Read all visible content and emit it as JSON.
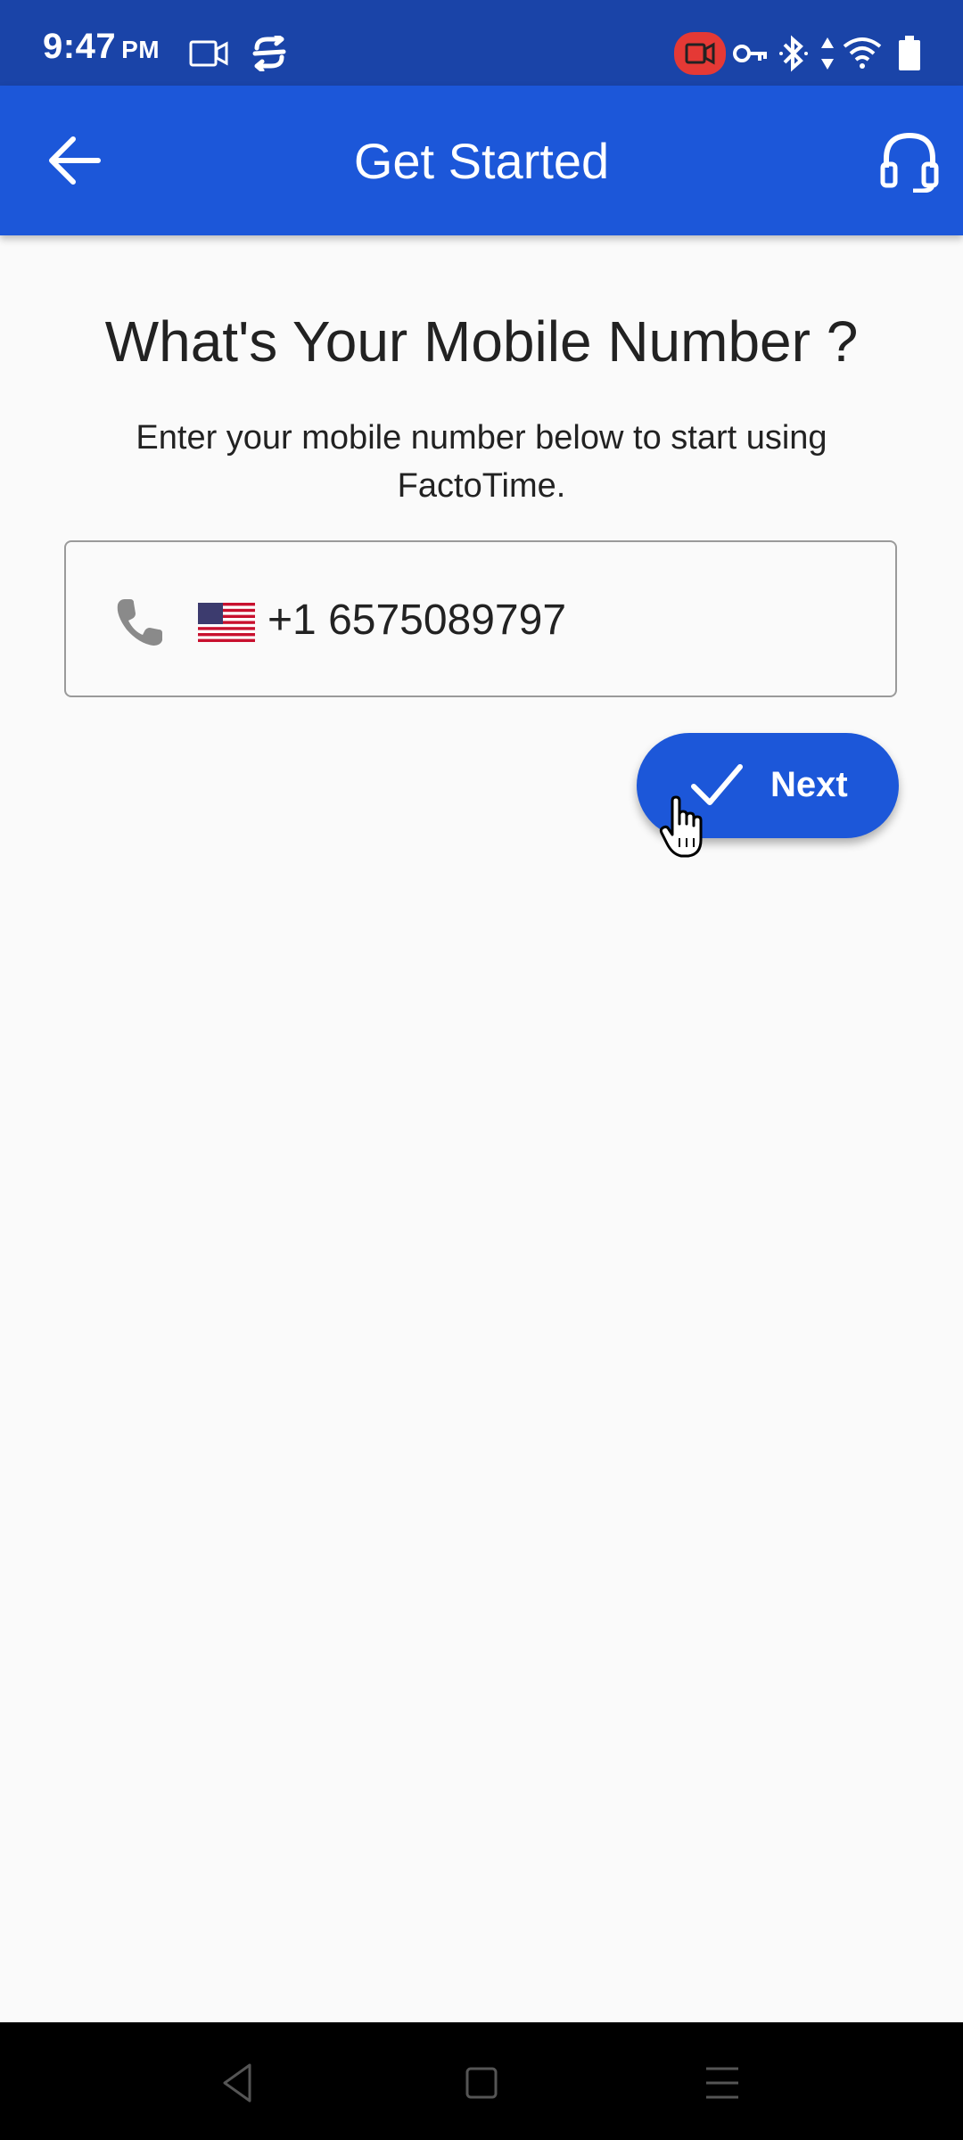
{
  "status_bar": {
    "time": "9:47",
    "ampm": "PM",
    "icons": [
      "screen-record-icon",
      "link-icon",
      "recording-indicator-icon",
      "vpn-key-icon",
      "bluetooth-icon",
      "data-arrows-icon",
      "wifi-icon",
      "battery-icon"
    ],
    "recording_color": "#e53935"
  },
  "app_bar": {
    "title": "Get Started",
    "back_icon": "arrow-left-icon",
    "support_icon": "headset-icon",
    "color": "#1c57d9"
  },
  "main": {
    "heading": "What's Your Mobile Number ?",
    "subtitle": "Enter your mobile number below to start using FactoTime.",
    "phone_field": {
      "icon": "phone-icon",
      "country_flag": "us-flag-icon",
      "value": "+1 6575089797"
    },
    "next_button": {
      "label": "Next",
      "icon": "checkmark-icon"
    }
  },
  "nav_bar": {
    "buttons": [
      "back-triangle-icon",
      "home-square-icon",
      "menu-lines-icon"
    ]
  }
}
